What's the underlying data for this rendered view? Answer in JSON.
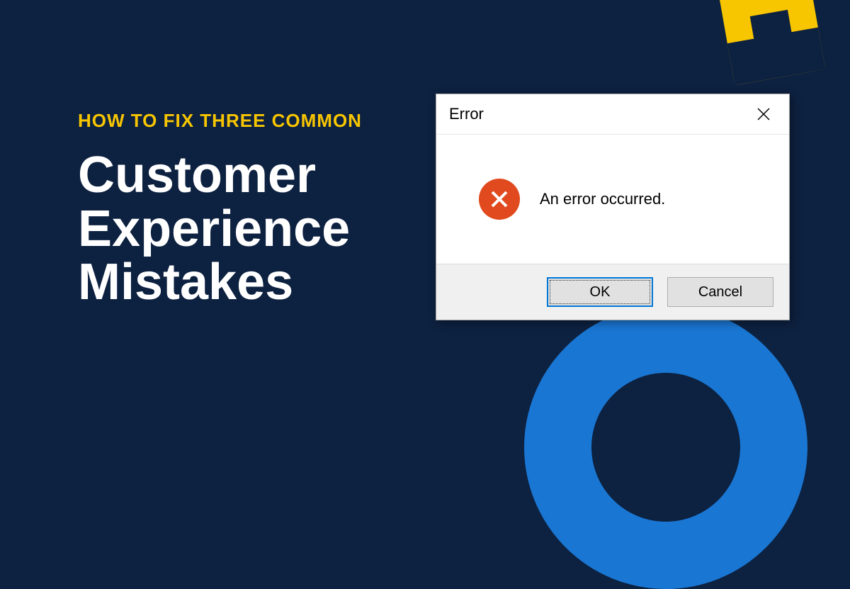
{
  "banner": {
    "kicker": "HOW TO FIX THREE COMMON",
    "headline_line1": "Customer",
    "headline_line2": "Experience",
    "headline_line3": "Mistakes"
  },
  "dialog": {
    "title": "Error",
    "message": "An error occurred.",
    "ok_label": "OK",
    "cancel_label": "Cancel"
  },
  "colors": {
    "background": "#0d2140",
    "accent_yellow": "#f7c600",
    "accent_blue": "#1976d2",
    "error_icon": "#e04a1e",
    "dialog_bg": "#f0f0f0",
    "button_focus": "#0078d7"
  }
}
